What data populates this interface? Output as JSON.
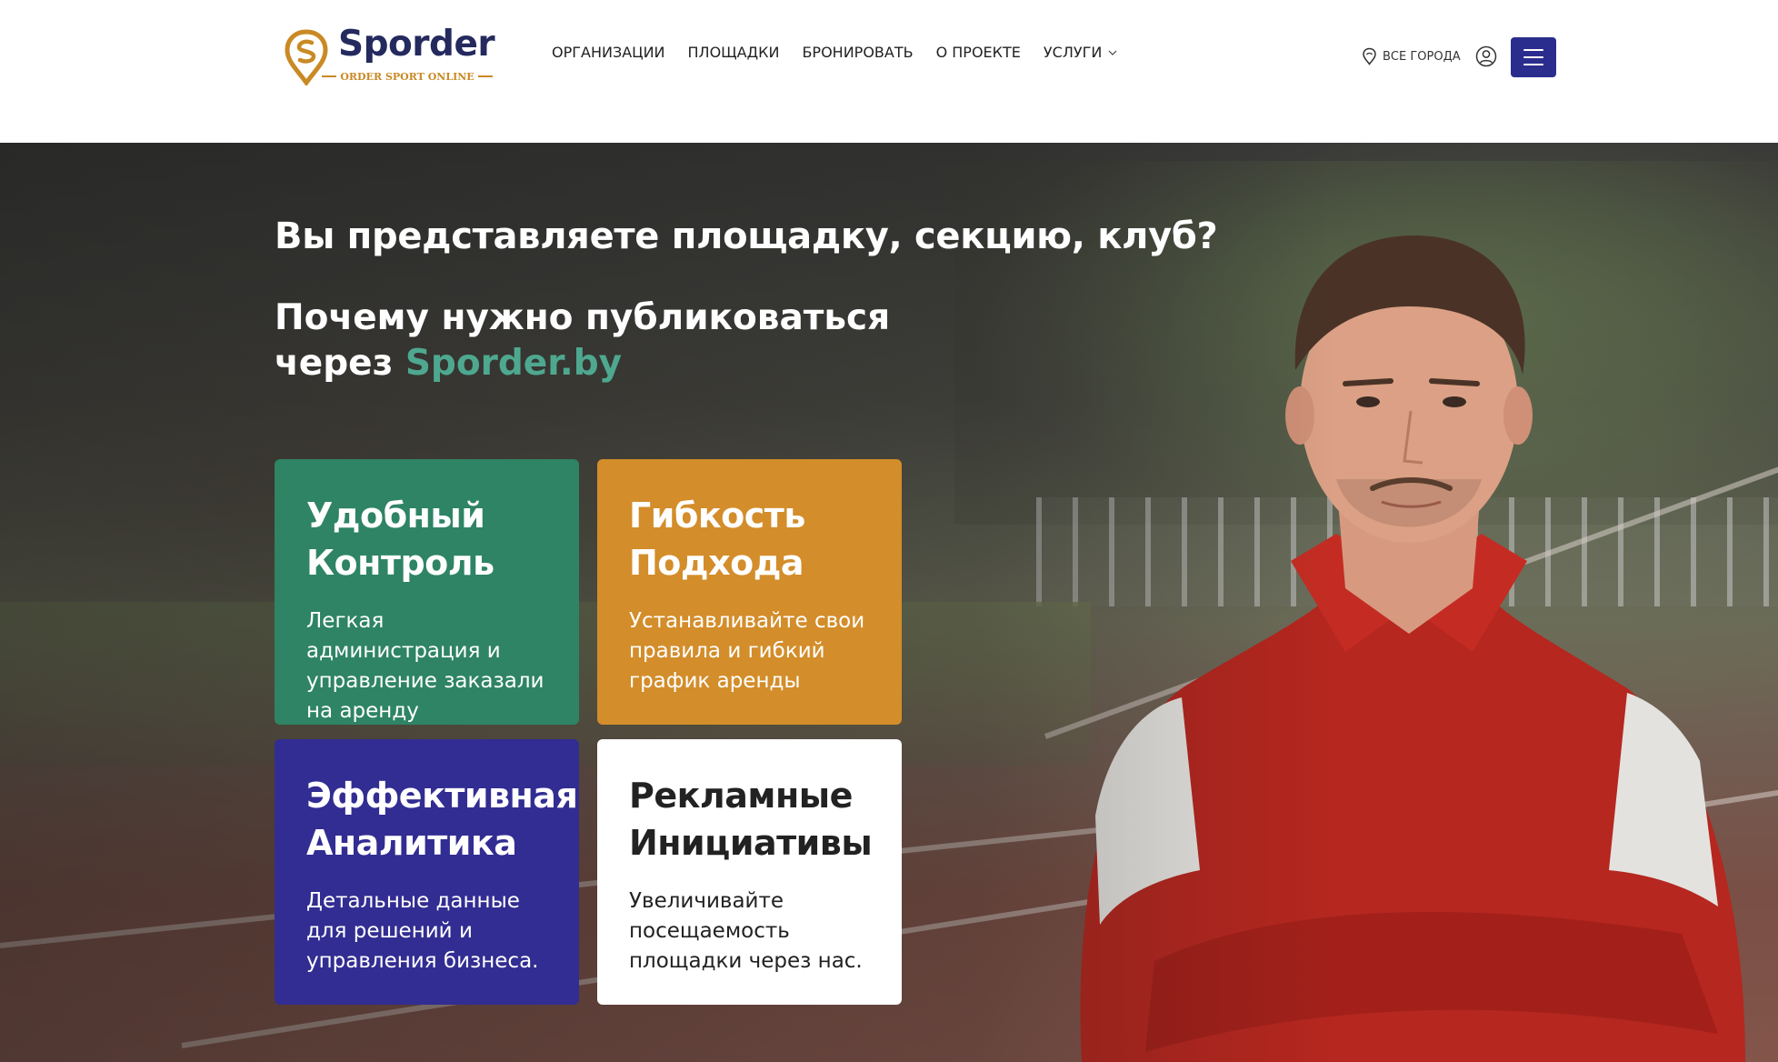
{
  "header": {
    "logo": {
      "name": "Sporder",
      "tagline": "ORDER SPORT ONLINE"
    },
    "nav": [
      {
        "label": "ОРГАНИЗАЦИИ"
      },
      {
        "label": "ПЛОЩАДКИ"
      },
      {
        "label": "БРОНИРОВАТЬ"
      },
      {
        "label": "О ПРОЕКТЕ"
      },
      {
        "label": "УСЛУГИ",
        "has_dropdown": true
      }
    ],
    "city_label": "ВСЕ ГОРОДА",
    "icons": [
      "map-pin-icon",
      "user-icon",
      "hamburger-menu-icon",
      "chevron-down-icon"
    ],
    "colors": {
      "brand_navy": "#242a5e",
      "brand_gold": "#c98a25",
      "menu_button": "#2b2d8e"
    }
  },
  "hero": {
    "question": "Вы представляете площадку, секцию, клуб?",
    "subtitle_line1": "Почему нужно публиковаться",
    "subtitle_line2_prefix": "через",
    "subtitle_brand": "Sporder.by",
    "brand_color": "#4ea88f",
    "cards": [
      {
        "title_line1": "Удобный",
        "title_line2": "Контроль",
        "text": "Легкая администрация и управление заказали на аренду",
        "color": "#2e8465"
      },
      {
        "title_line1": "Гибкость",
        "title_line2": "Подхода",
        "text": "Устанавливайте свои правила и гибкий график аренды",
        "color": "#d38d2a"
      },
      {
        "title_line1": "Эффективная",
        "title_line2": "Аналитика",
        "text": "Детальные данные для решений и управления бизнеса.",
        "color": "#322d92"
      },
      {
        "title_line1": "Рекламные",
        "title_line2": "Инициативы",
        "text": "Увеличивайте посещаемость площадки через нас.",
        "color": "#ffffff"
      }
    ]
  }
}
